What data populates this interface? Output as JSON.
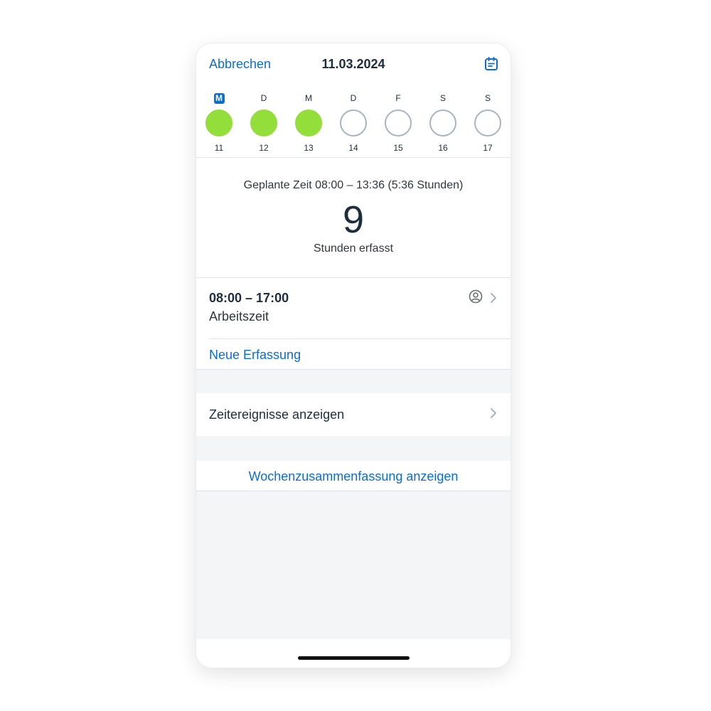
{
  "header": {
    "cancel_label": "Abbrechen",
    "date": "11.03.2024",
    "calendar_icon": "calendar-icon"
  },
  "week": {
    "days": [
      {
        "letter": "M",
        "number": "11",
        "recorded": true,
        "today": true
      },
      {
        "letter": "D",
        "number": "12",
        "recorded": true,
        "today": false
      },
      {
        "letter": "M",
        "number": "13",
        "recorded": true,
        "today": false
      },
      {
        "letter": "D",
        "number": "14",
        "recorded": false,
        "today": false
      },
      {
        "letter": "F",
        "number": "15",
        "recorded": false,
        "today": false
      },
      {
        "letter": "S",
        "number": "16",
        "recorded": false,
        "today": false
      },
      {
        "letter": "S",
        "number": "17",
        "recorded": false,
        "today": false
      }
    ]
  },
  "summary": {
    "planned": "Geplante Zeit 08:00 – 13:36 (5:36 Stunden)",
    "hours": "9",
    "hours_label": "Stunden erfasst"
  },
  "entry": {
    "time": "08:00 – 17:00",
    "type": "Arbeitszeit",
    "user_icon": "user-circle-icon",
    "chevron_icon": "chevron-right-icon"
  },
  "actions": {
    "new_entry": "Neue Erfassung",
    "time_events": "Zeitereignisse anzeigen",
    "week_summary": "Wochenzusammenfassung anzeigen"
  },
  "colors": {
    "accent": "#0a6ed1",
    "recorded_day": "#94de3c",
    "empty_day_border": "#a9b4be",
    "text_primary": "#1d2d3e"
  }
}
